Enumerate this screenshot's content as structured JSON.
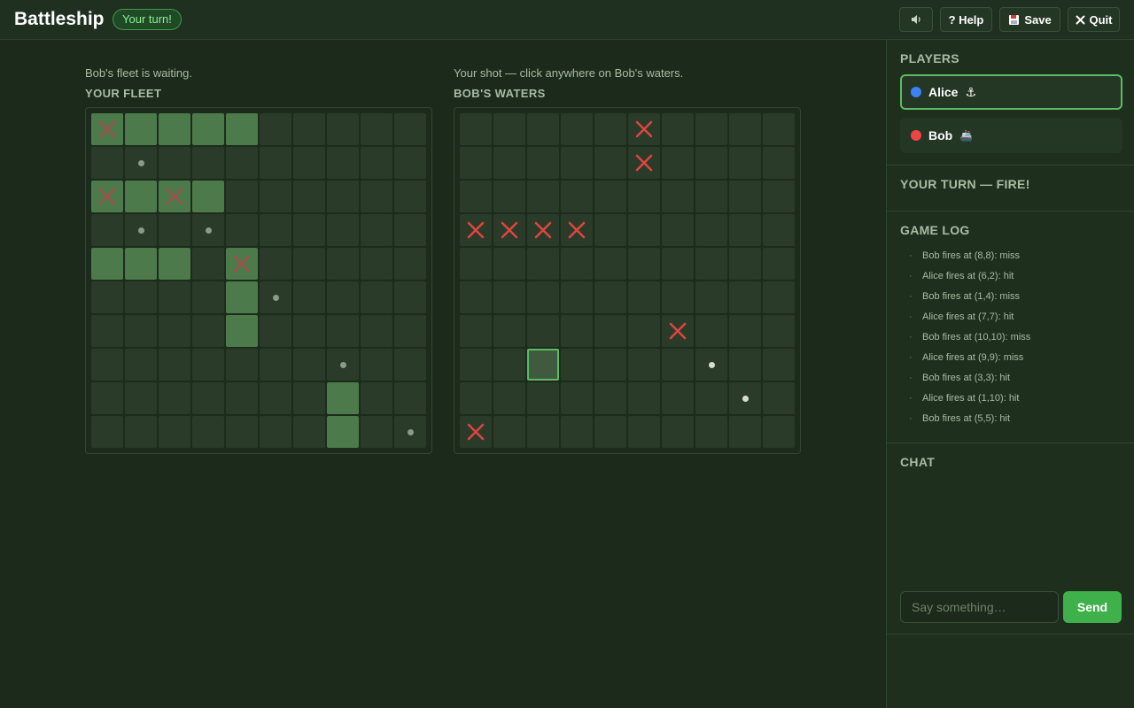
{
  "header": {
    "title": "Battleship",
    "turn_badge": "Your turn!",
    "sound_icon": "speaker-icon",
    "help_label": "? Help",
    "save_label": "Save",
    "save_icon": "floppy-disk-icon",
    "quit_label": "Quit",
    "quit_icon": "close-icon"
  },
  "fleet_board": {
    "status": "Bob's fleet is waiting.",
    "title": "YOUR FLEET",
    "rows": [
      [
        "H",
        "S",
        "S",
        "S",
        "S",
        ".",
        ".",
        ".",
        ".",
        "."
      ],
      [
        ".",
        "m",
        ".",
        ".",
        ".",
        ".",
        ".",
        ".",
        ".",
        "."
      ],
      [
        "H",
        "S",
        "H",
        "S",
        ".",
        ".",
        ".",
        ".",
        ".",
        "."
      ],
      [
        ".",
        "m",
        ".",
        "m",
        ".",
        ".",
        ".",
        ".",
        ".",
        "."
      ],
      [
        "S",
        "S",
        "S",
        ".",
        "H",
        ".",
        ".",
        ".",
        ".",
        "."
      ],
      [
        ".",
        ".",
        ".",
        ".",
        "S",
        "m",
        ".",
        ".",
        ".",
        "."
      ],
      [
        ".",
        ".",
        ".",
        ".",
        "S",
        ".",
        ".",
        ".",
        ".",
        "."
      ],
      [
        ".",
        ".",
        ".",
        ".",
        ".",
        ".",
        ".",
        "m",
        ".",
        "."
      ],
      [
        ".",
        ".",
        ".",
        ".",
        ".",
        ".",
        ".",
        "S",
        ".",
        "."
      ],
      [
        ".",
        ".",
        ".",
        ".",
        ".",
        ".",
        ".",
        "S",
        ".",
        "m"
      ]
    ]
  },
  "target_board": {
    "status": "Your shot — click anywhere on Bob's waters.",
    "title": "BOB'S WATERS",
    "selected": [
      7,
      2
    ],
    "rows": [
      [
        ".",
        ".",
        ".",
        ".",
        ".",
        "X",
        ".",
        ".",
        ".",
        "."
      ],
      [
        ".",
        ".",
        ".",
        ".",
        ".",
        "X",
        ".",
        ".",
        ".",
        "."
      ],
      [
        ".",
        ".",
        ".",
        ".",
        ".",
        ".",
        ".",
        ".",
        ".",
        "."
      ],
      [
        "X",
        "X",
        "X",
        "X",
        ".",
        ".",
        ".",
        ".",
        ".",
        "."
      ],
      [
        ".",
        ".",
        ".",
        ".",
        ".",
        ".",
        ".",
        ".",
        ".",
        "."
      ],
      [
        ".",
        ".",
        ".",
        ".",
        ".",
        ".",
        ".",
        ".",
        ".",
        "."
      ],
      [
        ".",
        ".",
        ".",
        ".",
        ".",
        ".",
        "X",
        ".",
        ".",
        "."
      ],
      [
        ".",
        ".",
        ".",
        ".",
        ".",
        ".",
        ".",
        "m",
        ".",
        "."
      ],
      [
        ".",
        ".",
        ".",
        ".",
        ".",
        ".",
        ".",
        ".",
        "m",
        "."
      ],
      [
        "X",
        ".",
        ".",
        ".",
        ".",
        ".",
        ".",
        ".",
        ".",
        "."
      ]
    ]
  },
  "sidebar": {
    "players_title": "PLAYERS",
    "players": [
      {
        "name": "Alice",
        "badge": "⚓",
        "color": "#3b82f6",
        "active": true
      },
      {
        "name": "Bob",
        "badge": "🚢",
        "color": "#ef4444",
        "active": false
      }
    ],
    "turn_text": "YOUR TURN — FIRE!",
    "log_title": "GAME LOG",
    "log": [
      "Bob fires at (8,8): miss",
      "Alice fires at (6,2): hit",
      "Bob fires at (1,4): miss",
      "Alice fires at (7,7): hit",
      "Bob fires at (10,10): miss",
      "Alice fires at (9,9): miss",
      "Bob fires at (3,3): hit",
      "Alice fires at (1,10): hit",
      "Bob fires at (5,5): hit"
    ],
    "chat_title": "CHAT",
    "chat_placeholder": "Say something…",
    "send_label": "Send"
  },
  "colors": {
    "ship": "#4d7a4a",
    "cell": "#2a3b29",
    "hit_x": "#e0453f",
    "selected_border": "#5dbb64"
  }
}
